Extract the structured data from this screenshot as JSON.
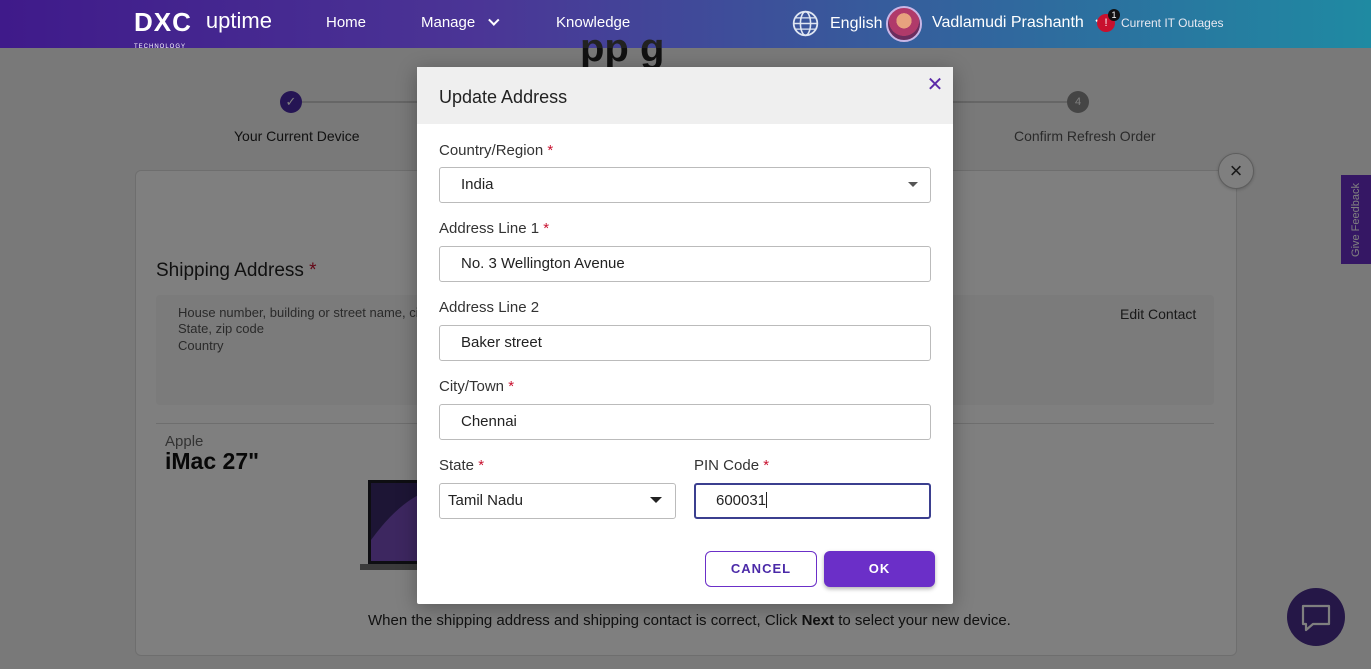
{
  "nav": {
    "logo_brand": "DXC",
    "logo_sub": "TECHNOLOGY",
    "logo_product": "uptime",
    "items": [
      "Home",
      "Manage",
      "Knowledge"
    ],
    "language": "English",
    "user_name": "Vadlamudi Prashanth",
    "alert_count": "1",
    "alert_link": "Current IT Outages"
  },
  "stepper": {
    "steps": [
      {
        "label": "Your Current Device",
        "status": "done"
      },
      {
        "label": "Confirm Refresh Order",
        "number": "4",
        "status": "pending"
      }
    ]
  },
  "page": {
    "title_fragment": "pp g",
    "shipping_title": "Shipping Address",
    "required_mark": "*",
    "address_placeholder": [
      "House number, building or street name, city",
      "State, zip code",
      "Country"
    ],
    "edit_contact": "Edit Contact",
    "device_brand": "Apple",
    "device_model": "iMac 27\"",
    "footer_pre": "When the shipping address and shipping contact is correct, Click ",
    "footer_bold": "Next",
    "footer_post": " to select your new device."
  },
  "feedback_tab": "Give Feedback",
  "modal": {
    "title": "Update Address",
    "fields": {
      "country": {
        "label": "Country/Region",
        "value": "India",
        "required": true
      },
      "address1": {
        "label": "Address Line 1",
        "value": "No. 3 Wellington Avenue",
        "required": true
      },
      "address2": {
        "label": "Address Line 2",
        "value": "Baker street",
        "required": false
      },
      "city": {
        "label": "City/Town",
        "value": "Chennai",
        "required": true
      },
      "state": {
        "label": "State",
        "value": "Tamil Nadu",
        "required": true
      },
      "pin": {
        "label": "PIN Code",
        "value": "600031",
        "required": true
      }
    },
    "cancel_label": "CANCEL",
    "ok_label": "OK"
  },
  "colors": {
    "accent": "#6b2fc8",
    "required": "#c8102e",
    "nav_start": "#3f1a8a",
    "nav_end": "#1f8aa2"
  }
}
